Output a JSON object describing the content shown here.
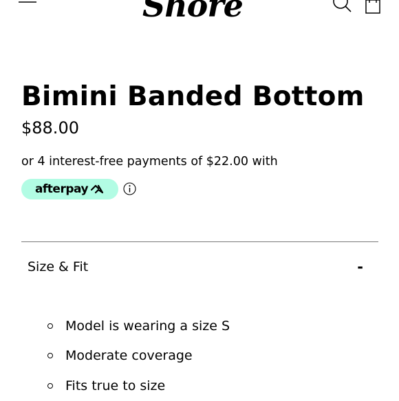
{
  "header": {
    "brand": "Shore",
    "icons": {
      "menu": "hamburger-menu-icon",
      "search": "search-icon",
      "bag": "shopping-bag-icon"
    }
  },
  "product": {
    "title": "Bimini Banded Bottom",
    "price": "$88.00"
  },
  "payment": {
    "installments_text": "or 4 interest-free payments of $22.00 with",
    "provider": "afterpay",
    "provider_color": "#b2fce4",
    "info_icon": "info-icon"
  },
  "details": {
    "section_title": "Size & Fit",
    "toggle_symbol": "-",
    "items": [
      "Model is wearing a size S",
      "Moderate coverage",
      "Fits true to size"
    ]
  }
}
